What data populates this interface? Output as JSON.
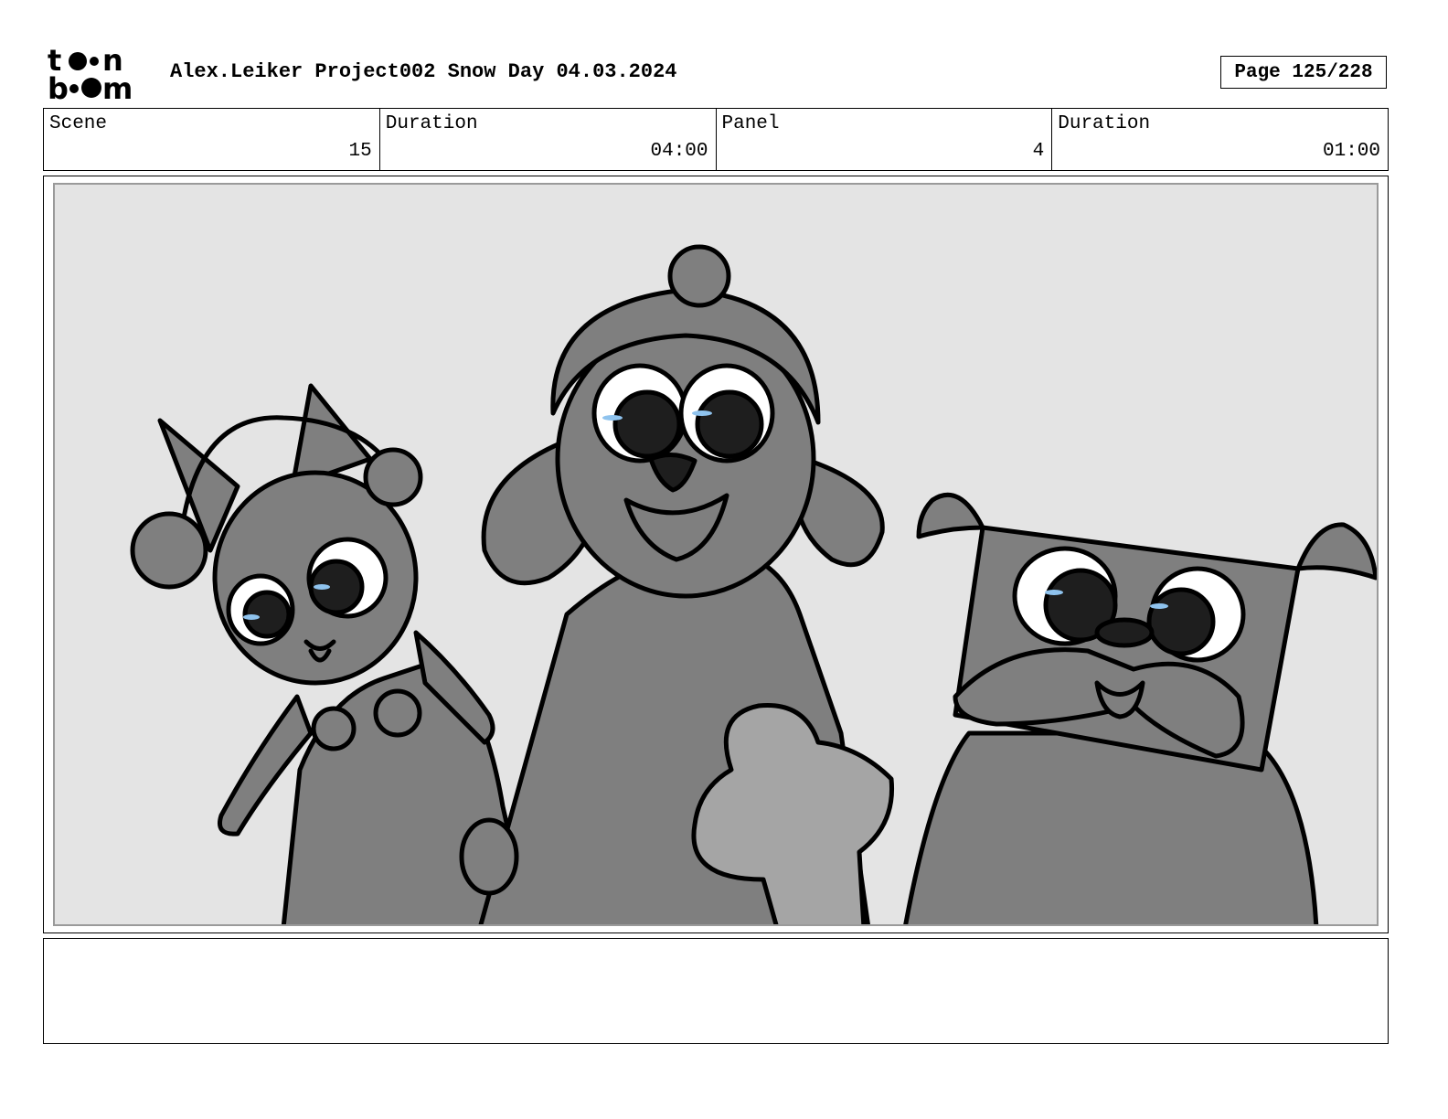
{
  "header": {
    "logo_text_top": "toon",
    "logo_text_bottom": "boom",
    "title": "Alex.Leiker Project002 Snow Day 04.03.2024",
    "page": "Page 125/228"
  },
  "info": {
    "scene_label": "Scene",
    "scene_value": "15",
    "scene_duration_label": "Duration",
    "scene_duration_value": "04:00",
    "panel_label": "Panel",
    "panel_value": "4",
    "panel_duration_label": "Duration",
    "panel_duration_value": "01:00"
  },
  "panel_image": {
    "background": "#e4e4e4",
    "character_fill": "#7f7f7f",
    "accent_tear": "#8fc3ee"
  },
  "notes": {
    "text": ""
  }
}
